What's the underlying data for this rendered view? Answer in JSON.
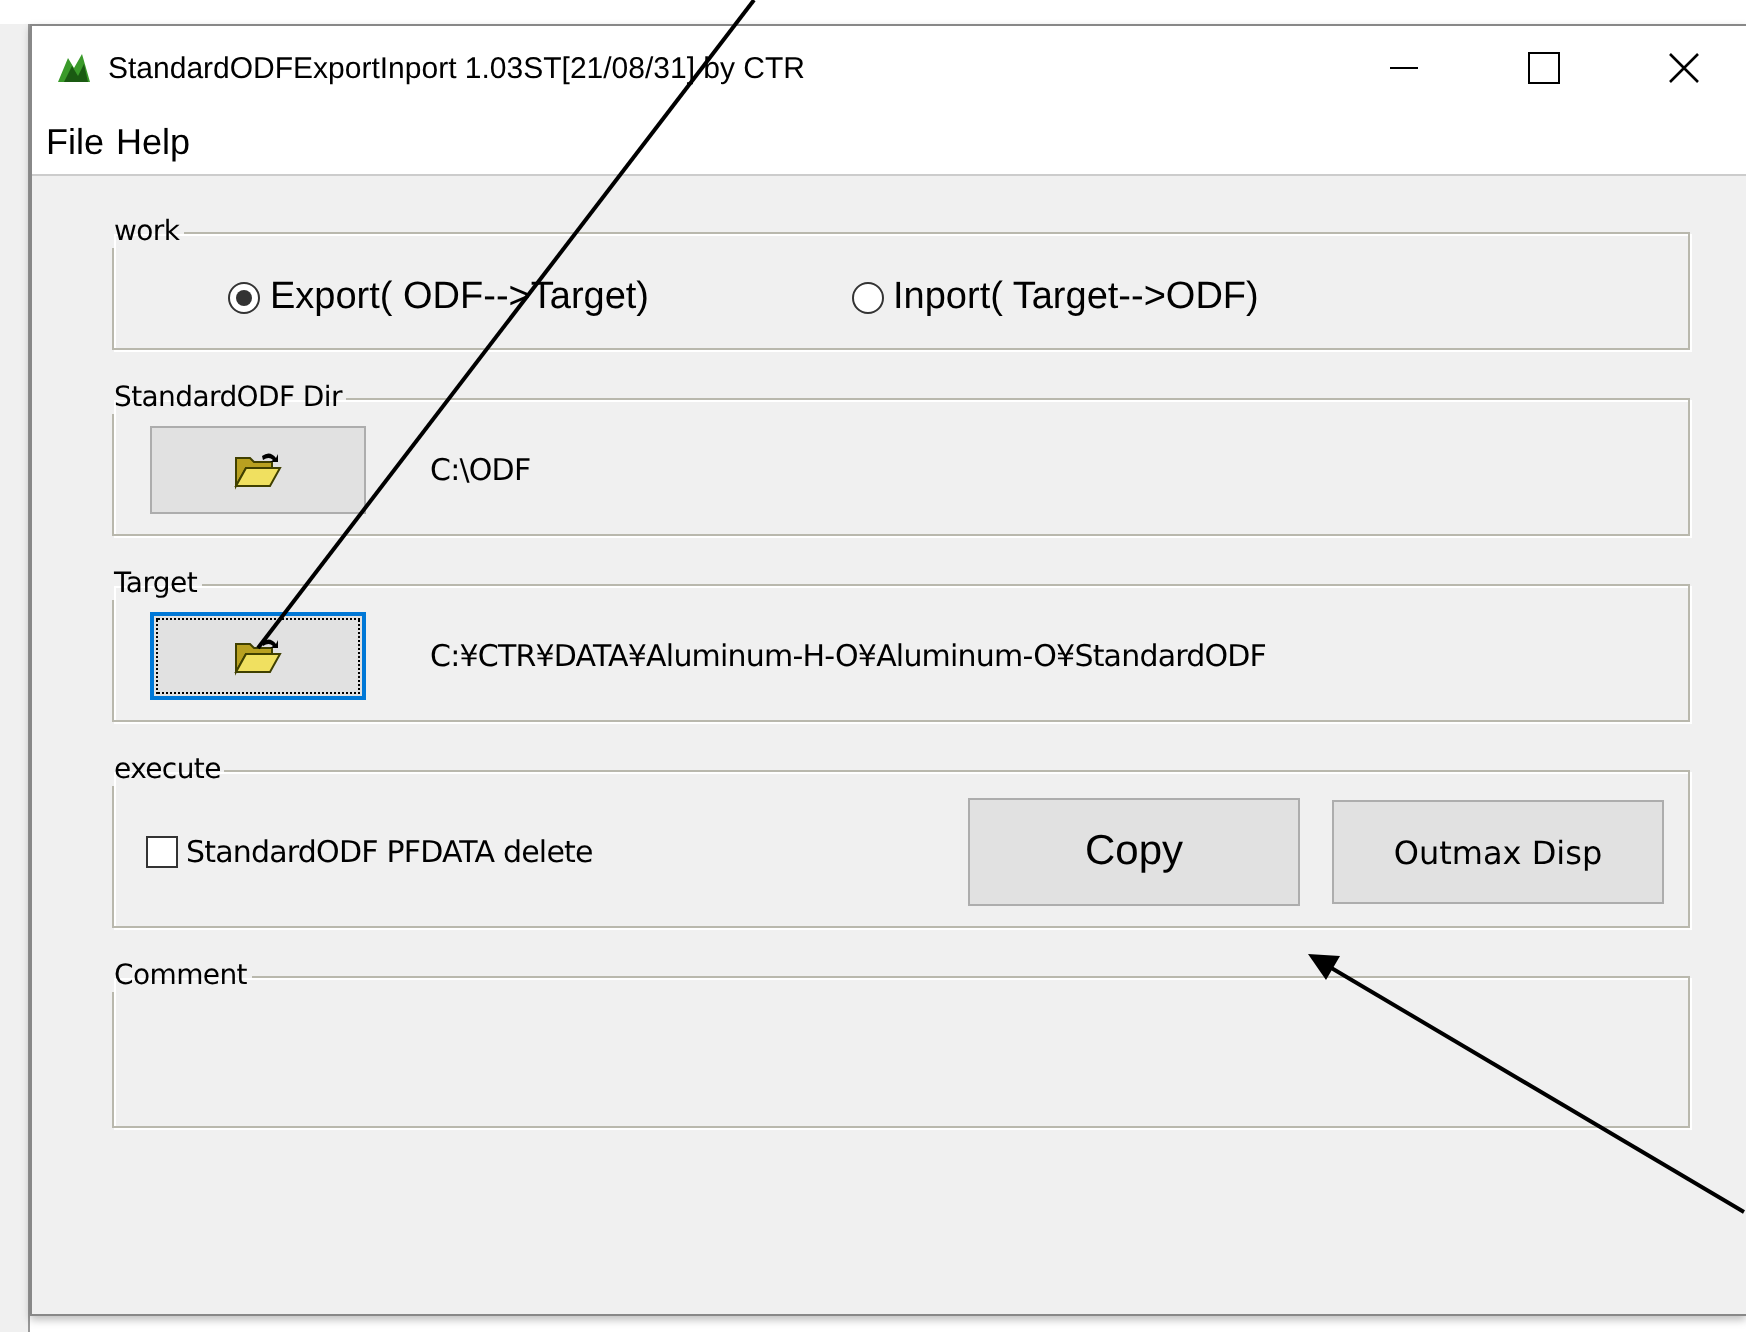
{
  "window": {
    "title": "StandardODFExportInport 1.03ST[21/08/31] by CTR"
  },
  "menu": [
    {
      "label": "File"
    },
    {
      "label": "Help"
    }
  ],
  "work": {
    "title": "work",
    "options": [
      {
        "label": "Export( ODF-->Target)",
        "selected": true
      },
      {
        "label": "Inport( Target-->ODF)",
        "selected": false
      }
    ]
  },
  "folders": [
    {
      "title": "StandardODF Dir",
      "path": "C:\\ODF",
      "focused": false
    },
    {
      "title": "Target",
      "path": "C:¥CTR¥DATA¥Aluminum-H-O¥Aluminum-O¥StandardODF",
      "focused": true
    }
  ],
  "execute": {
    "title": "execute",
    "checkbox": {
      "label": "StandardODF PFDATA delete",
      "checked": false
    },
    "buttons": [
      {
        "label": "Copy",
        "kind": "large"
      },
      {
        "label": "Outmax Disp",
        "kind": "small"
      }
    ]
  },
  "comment": {
    "title": "Comment"
  }
}
